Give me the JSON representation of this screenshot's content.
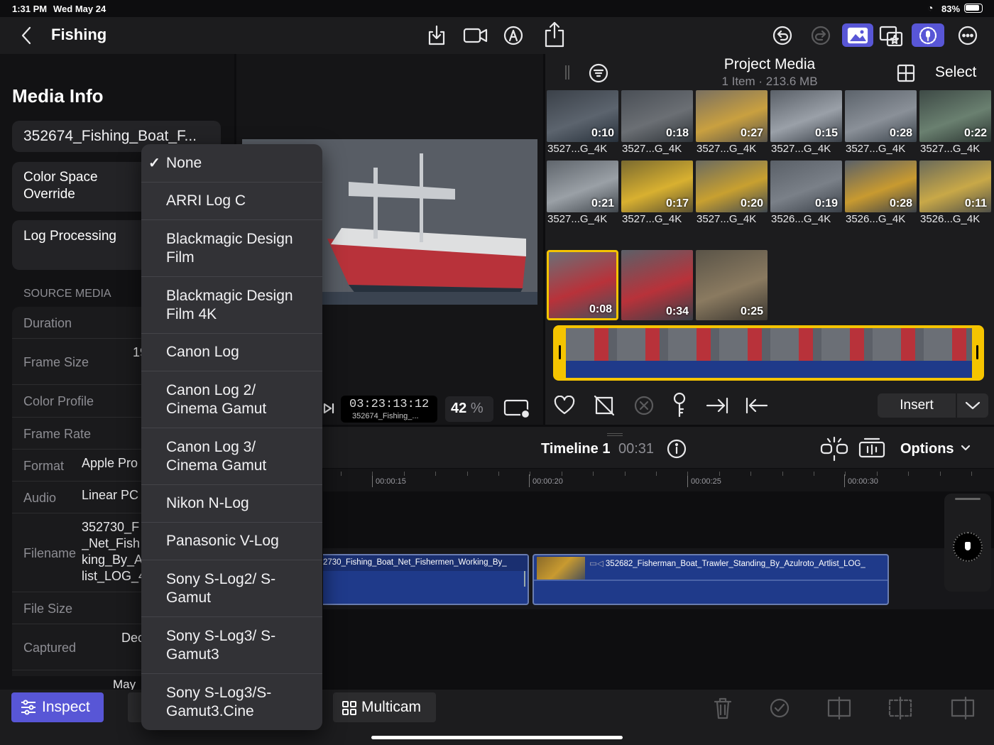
{
  "status": {
    "time": "1:31 PM",
    "date": "Wed May 24",
    "battery": "83%"
  },
  "header": {
    "title": "Fishing"
  },
  "inspector": {
    "heading": "Media Info",
    "clip_name": "352674_Fishing_Boat_F...",
    "color_space_label": "Color Space Override",
    "log_label": "Log Processing",
    "section": "SOURCE MEDIA",
    "rows": [
      {
        "label": "Duration",
        "value": ""
      },
      {
        "label": "Frame Size",
        "value": "19 10"
      },
      {
        "label": "Color Profile",
        "value": ""
      },
      {
        "label": "Frame Rate",
        "value": ""
      },
      {
        "label": "Format",
        "value": "Apple Pro"
      },
      {
        "label": "Audio",
        "value": "Linear PC"
      },
      {
        "label": "Filename",
        "value": "352730_F _Net_Fish king_By_A list_LOG_4"
      },
      {
        "label": "File Size",
        "value": ""
      },
      {
        "label": "Captured",
        "value": "Dec 7:2"
      }
    ],
    "extra": "May"
  },
  "color_menu": {
    "selected_index": 0,
    "items": [
      "None",
      "ARRI Log C",
      "Blackmagic Design Film",
      "Blackmagic Design Film 4K",
      "Canon Log",
      "Canon Log 2/ Cinema Gamut",
      "Canon Log 3/ Cinema Gamut",
      "Nikon N-Log",
      "Panasonic V-Log",
      "Sony S-Log2/ S-Gamut",
      "Sony S-Log3/ S-Gamut3",
      "Sony S-Log3/S-Gamut3.Cine"
    ]
  },
  "viewer": {
    "timecode": "03:23:13:12",
    "timecode_sub": "352674_Fishing_...",
    "zoom": "42",
    "zoom_unit": "%"
  },
  "browser": {
    "title": "Project Media",
    "subtitle": "1 Item  ·  213.6 MB",
    "select_label": "Select",
    "thumbs": [
      {
        "dur": "0:10",
        "name": "3527...G_4K"
      },
      {
        "dur": "0:18",
        "name": "3527...G_4K"
      },
      {
        "dur": "0:27",
        "name": "3527...G_4K"
      },
      {
        "dur": "0:15",
        "name": "3527...G_4K"
      },
      {
        "dur": "0:28",
        "name": "3527...G_4K"
      },
      {
        "dur": "0:22",
        "name": "3527...G_4K"
      },
      {
        "dur": "0:21",
        "name": "3527...G_4K"
      },
      {
        "dur": "0:17",
        "name": "3527...G_4K"
      },
      {
        "dur": "0:20",
        "name": "3527...G_4K"
      },
      {
        "dur": "0:19",
        "name": "3526...G_4K"
      },
      {
        "dur": "0:28",
        "name": "3526...G_4K"
      },
      {
        "dur": "0:11",
        "name": "3526...G_4K"
      },
      {
        "dur": "0:08",
        "name": ""
      },
      {
        "dur": "0:34",
        "name": ""
      },
      {
        "dur": "0:25",
        "name": ""
      }
    ],
    "insert_label": "Insert"
  },
  "timeline": {
    "title": "Timeline 1",
    "duration": "00:31",
    "options_label": "Options",
    "ticks": [
      "00:00:15",
      "00:00:20",
      "00:00:25",
      "00:00:30"
    ],
    "clip1": "2730_Fishing_Boat_Net_Fishermen_Working_By_",
    "clip2": "352682_Fisherman_Boat_Trawler_Standing_By_Azulroto_Artlist_LOG_"
  },
  "bottom": {
    "inspect_label": "Inspect",
    "multicam_label": "Multicam"
  },
  "colors": {
    "accent": "#5856d6",
    "selection": "#f5c400",
    "clip_blue": "#1f3a8a"
  }
}
